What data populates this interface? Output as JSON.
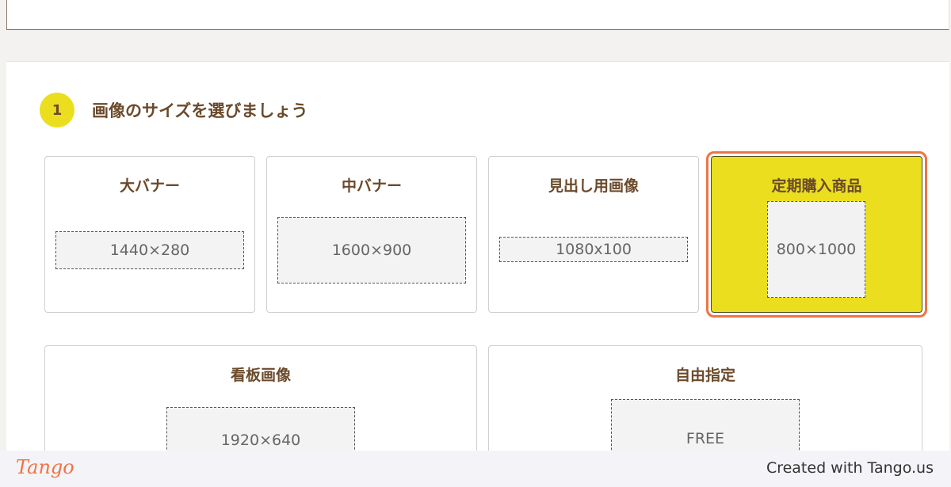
{
  "step": {
    "number": "1",
    "title": "画像のサイズを選びましょう"
  },
  "options": [
    {
      "title": "大バナー",
      "size": "1440×280",
      "selected": false
    },
    {
      "title": "中バナー",
      "size": "1600×900",
      "selected": false
    },
    {
      "title": "見出し用画像",
      "size": "1080x100",
      "selected": false
    },
    {
      "title": "定期購入商品",
      "size": "800×1000",
      "selected": true
    },
    {
      "title": "看板画像",
      "size": "1920×640",
      "selected": false
    },
    {
      "title": "自由指定",
      "size": "FREE",
      "selected": false
    }
  ],
  "footer": {
    "logo": "Tango",
    "credit": "Created with Tango.us"
  },
  "colors": {
    "accent_yellow": "#ebde1e",
    "selection_ring": "#ee7445",
    "heading_brown": "#6b4a2b"
  }
}
